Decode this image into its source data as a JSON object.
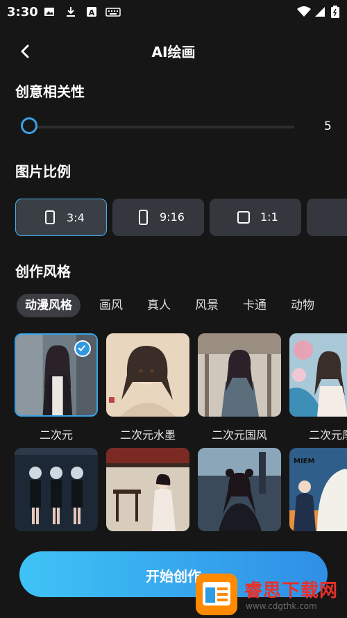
{
  "status": {
    "time": "3:30"
  },
  "header": {
    "title": "AI绘画"
  },
  "creativity": {
    "label": "创意相关性",
    "value": "5",
    "level_fraction": 0.0
  },
  "ratio": {
    "label": "图片比例",
    "options": [
      {
        "label": "3:4",
        "selected": true
      },
      {
        "label": "9:16",
        "selected": false
      },
      {
        "label": "1:1",
        "selected": false
      }
    ]
  },
  "style": {
    "label": "创作风格",
    "tabs": [
      "动漫风格",
      "画风",
      "真人",
      "风景",
      "卡通",
      "动物"
    ],
    "cards_row1": [
      "二次元",
      "二次元水墨",
      "二次元国风",
      "二次元厚"
    ]
  },
  "cta": {
    "label": "开始创作"
  },
  "watermark": {
    "brand": "睿思下载网",
    "url": "www.cdgthk.com"
  },
  "colors": {
    "accent": "#3aa3e6",
    "background": "#161616",
    "card": "#34373d"
  }
}
